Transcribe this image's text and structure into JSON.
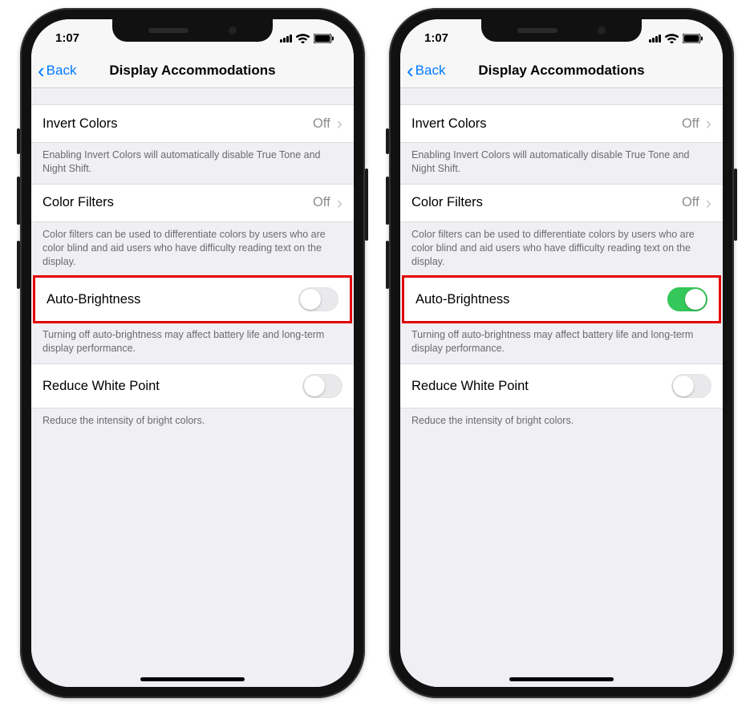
{
  "statusbar": {
    "time": "1:07"
  },
  "navbar": {
    "back_label": "Back",
    "title": "Display Accommodations"
  },
  "rows": {
    "invert": {
      "label": "Invert Colors",
      "value": "Off",
      "footer": "Enabling Invert Colors will automatically disable True Tone and Night Shift."
    },
    "filters": {
      "label": "Color Filters",
      "value": "Off",
      "footer": "Color filters can be used to differentiate colors by users who are color blind and aid users who have difficulty reading text on the display."
    },
    "auto": {
      "label": "Auto-Brightness",
      "footer": "Turning off auto-brightness may affect battery life and long-term display performance."
    },
    "white": {
      "label": "Reduce White Point",
      "footer": "Reduce the intensity of bright colors."
    }
  },
  "phones": [
    {
      "auto_brightness_on": false
    },
    {
      "auto_brightness_on": true
    }
  ]
}
